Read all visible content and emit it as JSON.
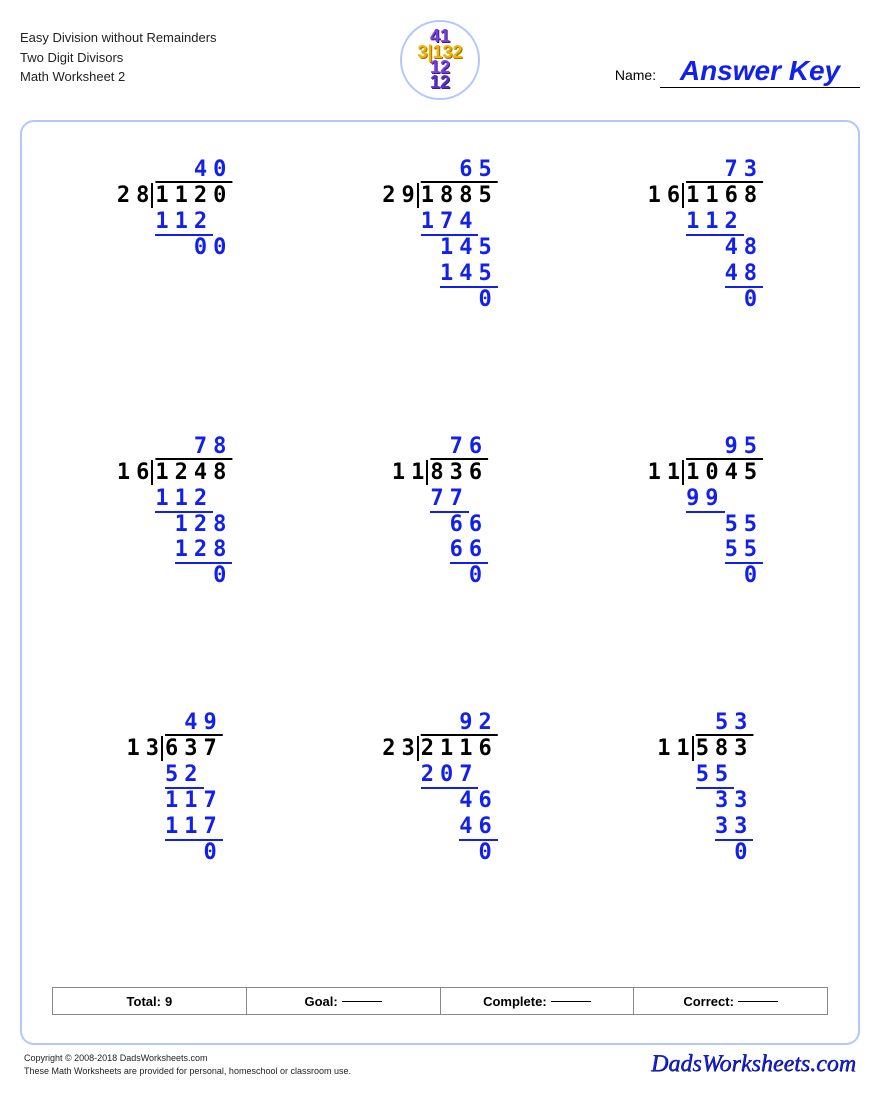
{
  "header": {
    "title1": "Easy Division without Remainders",
    "title2": "Two Digit Divisors",
    "title3": "Math Worksheet 2",
    "name_label": "Name:",
    "answer_key": "Answer Key"
  },
  "badge": {
    "l1": "41",
    "l2": "3|132",
    "l3": "12",
    "l4": "12"
  },
  "problems": [
    {
      "divisor": "28",
      "dividend": "1120",
      "quotient": "40",
      "work": [
        {
          "t": "112",
          "u": true,
          "pad": 1
        },
        {
          "t": "00",
          "pad": 0
        }
      ]
    },
    {
      "divisor": "29",
      "dividend": "1885",
      "quotient": "65",
      "work": [
        {
          "t": "174",
          "u": true,
          "pad": 1
        },
        {
          "t": "145",
          "pad": 0
        },
        {
          "t": "145",
          "u": true,
          "pad": 0
        },
        {
          "t": "0",
          "pad": 0
        }
      ]
    },
    {
      "divisor": "16",
      "dividend": "1168",
      "quotient": "73",
      "work": [
        {
          "t": "112",
          "u": true,
          "pad": 1
        },
        {
          "t": "48",
          "pad": 0
        },
        {
          "t": "48",
          "u": true,
          "pad": 0
        },
        {
          "t": "0",
          "pad": 0
        }
      ]
    },
    {
      "divisor": "16",
      "dividend": "1248",
      "quotient": "78",
      "work": [
        {
          "t": "112",
          "u": true,
          "pad": 1
        },
        {
          "t": "128",
          "pad": 0
        },
        {
          "t": "128",
          "u": true,
          "pad": 0
        },
        {
          "t": "0",
          "pad": 0
        }
      ]
    },
    {
      "divisor": "11",
      "dividend": "836",
      "quotient": "76",
      "work": [
        {
          "t": "77",
          "u": true,
          "pad": 1
        },
        {
          "t": "66",
          "pad": 0
        },
        {
          "t": "66",
          "u": true,
          "pad": 0
        },
        {
          "t": "0",
          "pad": 0
        }
      ]
    },
    {
      "divisor": "11",
      "dividend": "1045",
      "quotient": "95",
      "work": [
        {
          "t": "99",
          "u": true,
          "pad": 2
        },
        {
          "t": "55",
          "pad": 0
        },
        {
          "t": "55",
          "u": true,
          "pad": 0
        },
        {
          "t": "0",
          "pad": 0
        }
      ]
    },
    {
      "divisor": "13",
      "dividend": "637",
      "quotient": "49",
      "work": [
        {
          "t": "52",
          "u": true,
          "pad": 1
        },
        {
          "t": "117",
          "pad": 0
        },
        {
          "t": "117",
          "u": true,
          "pad": 0
        },
        {
          "t": "0",
          "pad": 0
        }
      ]
    },
    {
      "divisor": "23",
      "dividend": "2116",
      "quotient": "92",
      "work": [
        {
          "t": "207",
          "u": true,
          "pad": 1
        },
        {
          "t": "46",
          "pad": 0
        },
        {
          "t": "46",
          "u": true,
          "pad": 0
        },
        {
          "t": "0",
          "pad": 0
        }
      ]
    },
    {
      "divisor": "11",
      "dividend": "583",
      "quotient": "53",
      "work": [
        {
          "t": "55",
          "u": true,
          "pad": 1
        },
        {
          "t": "33",
          "pad": 0
        },
        {
          "t": "33",
          "u": true,
          "pad": 0
        },
        {
          "t": "0",
          "pad": 0
        }
      ]
    }
  ],
  "stats": {
    "total_label": "Total:",
    "total_value": "9",
    "goal_label": "Goal:",
    "complete_label": "Complete:",
    "correct_label": "Correct:"
  },
  "footer": {
    "copyright": "Copyright © 2008-2018 DadsWorksheets.com",
    "note": "These Math Worksheets are provided for personal, homeschool or classroom use.",
    "brand": "DadsWorksheets.com"
  }
}
